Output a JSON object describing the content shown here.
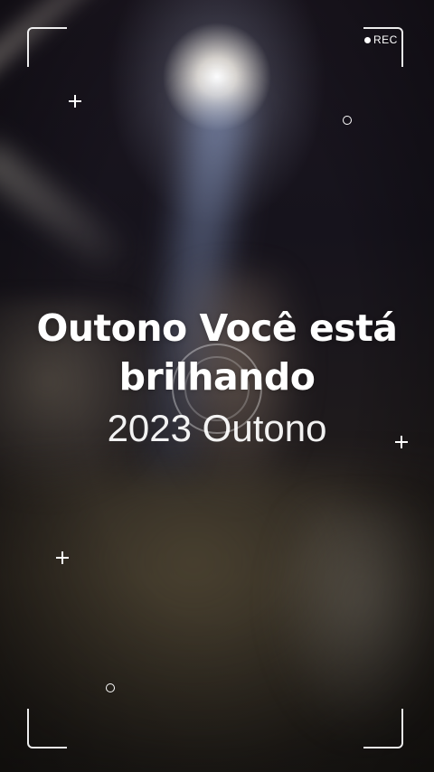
{
  "recorder": {
    "rec_label": "REC"
  },
  "caption": {
    "line1": "Outono Você está",
    "line2": "brilhando",
    "subtitle": "2023 Outono"
  },
  "colors": {
    "overlay_text": "#ffffff",
    "background_dark": "#0d0a10"
  }
}
